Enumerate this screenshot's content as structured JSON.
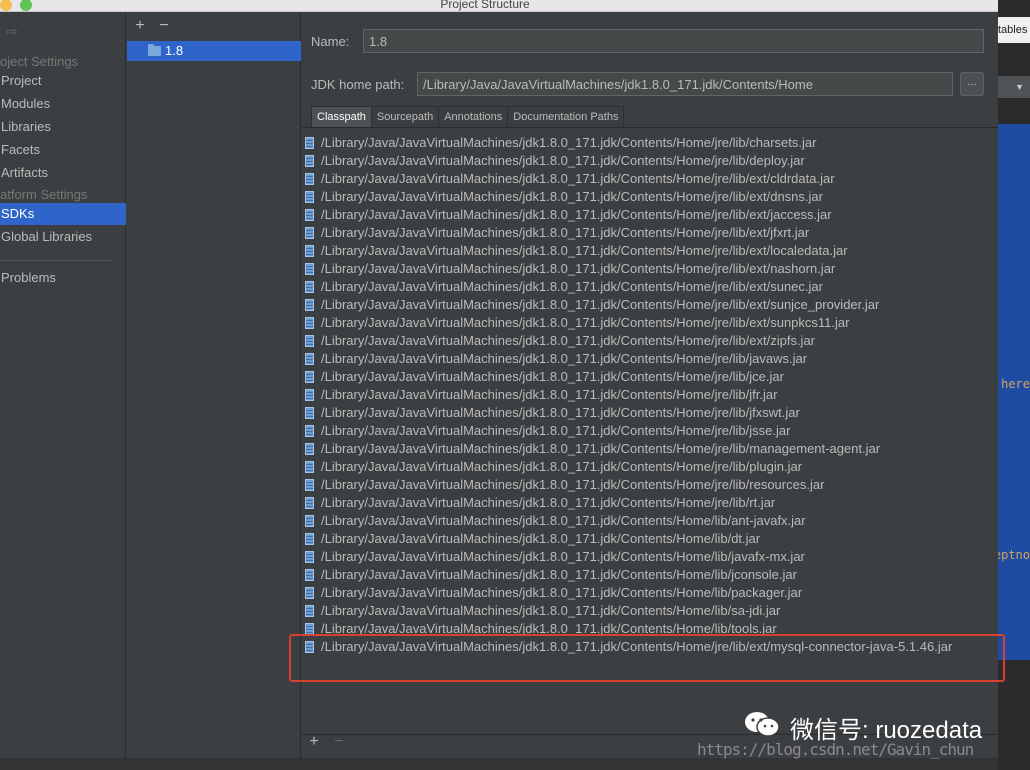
{
  "window": {
    "title": "Project Structure"
  },
  "background_window": {
    "tab_fragment": "tables",
    "word_1": "here",
    "word_2": "eptno"
  },
  "nav": {
    "section_project_settings": "oject Settings",
    "items_project": [
      "Project",
      "Modules",
      "Libraries",
      "Facets",
      "Artifacts"
    ],
    "section_platform_settings": "atform Settings",
    "items_platform": [
      "SDKs",
      "Global Libraries"
    ],
    "selected": "SDKs",
    "problems": "Problems"
  },
  "sdk_list": {
    "add_label": "+",
    "remove_label": "−",
    "items": [
      "1.8"
    ]
  },
  "detail": {
    "name_label": "Name:",
    "name_value": "1.8",
    "home_label": "JDK home path:",
    "home_value": "/Library/Java/JavaVirtualMachines/jdk1.8.0_171.jdk/Contents/Home",
    "browse_label": "...",
    "tabs": [
      "Classpath",
      "Sourcepath",
      "Annotations",
      "Documentation Paths"
    ],
    "active_tab": "Classpath",
    "classpath": [
      "/Library/Java/JavaVirtualMachines/jdk1.8.0_171.jdk/Contents/Home/jre/lib/charsets.jar",
      "/Library/Java/JavaVirtualMachines/jdk1.8.0_171.jdk/Contents/Home/jre/lib/deploy.jar",
      "/Library/Java/JavaVirtualMachines/jdk1.8.0_171.jdk/Contents/Home/jre/lib/ext/cldrdata.jar",
      "/Library/Java/JavaVirtualMachines/jdk1.8.0_171.jdk/Contents/Home/jre/lib/ext/dnsns.jar",
      "/Library/Java/JavaVirtualMachines/jdk1.8.0_171.jdk/Contents/Home/jre/lib/ext/jaccess.jar",
      "/Library/Java/JavaVirtualMachines/jdk1.8.0_171.jdk/Contents/Home/jre/lib/ext/jfxrt.jar",
      "/Library/Java/JavaVirtualMachines/jdk1.8.0_171.jdk/Contents/Home/jre/lib/ext/localedata.jar",
      "/Library/Java/JavaVirtualMachines/jdk1.8.0_171.jdk/Contents/Home/jre/lib/ext/nashorn.jar",
      "/Library/Java/JavaVirtualMachines/jdk1.8.0_171.jdk/Contents/Home/jre/lib/ext/sunec.jar",
      "/Library/Java/JavaVirtualMachines/jdk1.8.0_171.jdk/Contents/Home/jre/lib/ext/sunjce_provider.jar",
      "/Library/Java/JavaVirtualMachines/jdk1.8.0_171.jdk/Contents/Home/jre/lib/ext/sunpkcs11.jar",
      "/Library/Java/JavaVirtualMachines/jdk1.8.0_171.jdk/Contents/Home/jre/lib/ext/zipfs.jar",
      "/Library/Java/JavaVirtualMachines/jdk1.8.0_171.jdk/Contents/Home/jre/lib/javaws.jar",
      "/Library/Java/JavaVirtualMachines/jdk1.8.0_171.jdk/Contents/Home/jre/lib/jce.jar",
      "/Library/Java/JavaVirtualMachines/jdk1.8.0_171.jdk/Contents/Home/jre/lib/jfr.jar",
      "/Library/Java/JavaVirtualMachines/jdk1.8.0_171.jdk/Contents/Home/jre/lib/jfxswt.jar",
      "/Library/Java/JavaVirtualMachines/jdk1.8.0_171.jdk/Contents/Home/jre/lib/jsse.jar",
      "/Library/Java/JavaVirtualMachines/jdk1.8.0_171.jdk/Contents/Home/jre/lib/management-agent.jar",
      "/Library/Java/JavaVirtualMachines/jdk1.8.0_171.jdk/Contents/Home/jre/lib/plugin.jar",
      "/Library/Java/JavaVirtualMachines/jdk1.8.0_171.jdk/Contents/Home/jre/lib/resources.jar",
      "/Library/Java/JavaVirtualMachines/jdk1.8.0_171.jdk/Contents/Home/jre/lib/rt.jar",
      "/Library/Java/JavaVirtualMachines/jdk1.8.0_171.jdk/Contents/Home/lib/ant-javafx.jar",
      "/Library/Java/JavaVirtualMachines/jdk1.8.0_171.jdk/Contents/Home/lib/dt.jar",
      "/Library/Java/JavaVirtualMachines/jdk1.8.0_171.jdk/Contents/Home/lib/javafx-mx.jar",
      "/Library/Java/JavaVirtualMachines/jdk1.8.0_171.jdk/Contents/Home/lib/jconsole.jar",
      "/Library/Java/JavaVirtualMachines/jdk1.8.0_171.jdk/Contents/Home/lib/packager.jar",
      "/Library/Java/JavaVirtualMachines/jdk1.8.0_171.jdk/Contents/Home/lib/sa-jdi.jar",
      "/Library/Java/JavaVirtualMachines/jdk1.8.0_171.jdk/Contents/Home/lib/tools.jar",
      "/Library/Java/JavaVirtualMachines/jdk1.8.0_171.jdk/Contents/Home/jre/lib/ext/mysql-connector-java-5.1.46.jar"
    ],
    "highlighted_index": 28,
    "add_label": "+",
    "remove_label": "−"
  },
  "watermark": {
    "main": "微信号: ruozedata",
    "url": "https://blog.csdn.net/Gavin_chun"
  },
  "colors": {
    "selection": "#2f65ca",
    "highlight_border": "#d9412f",
    "panel": "#3c3f41"
  }
}
